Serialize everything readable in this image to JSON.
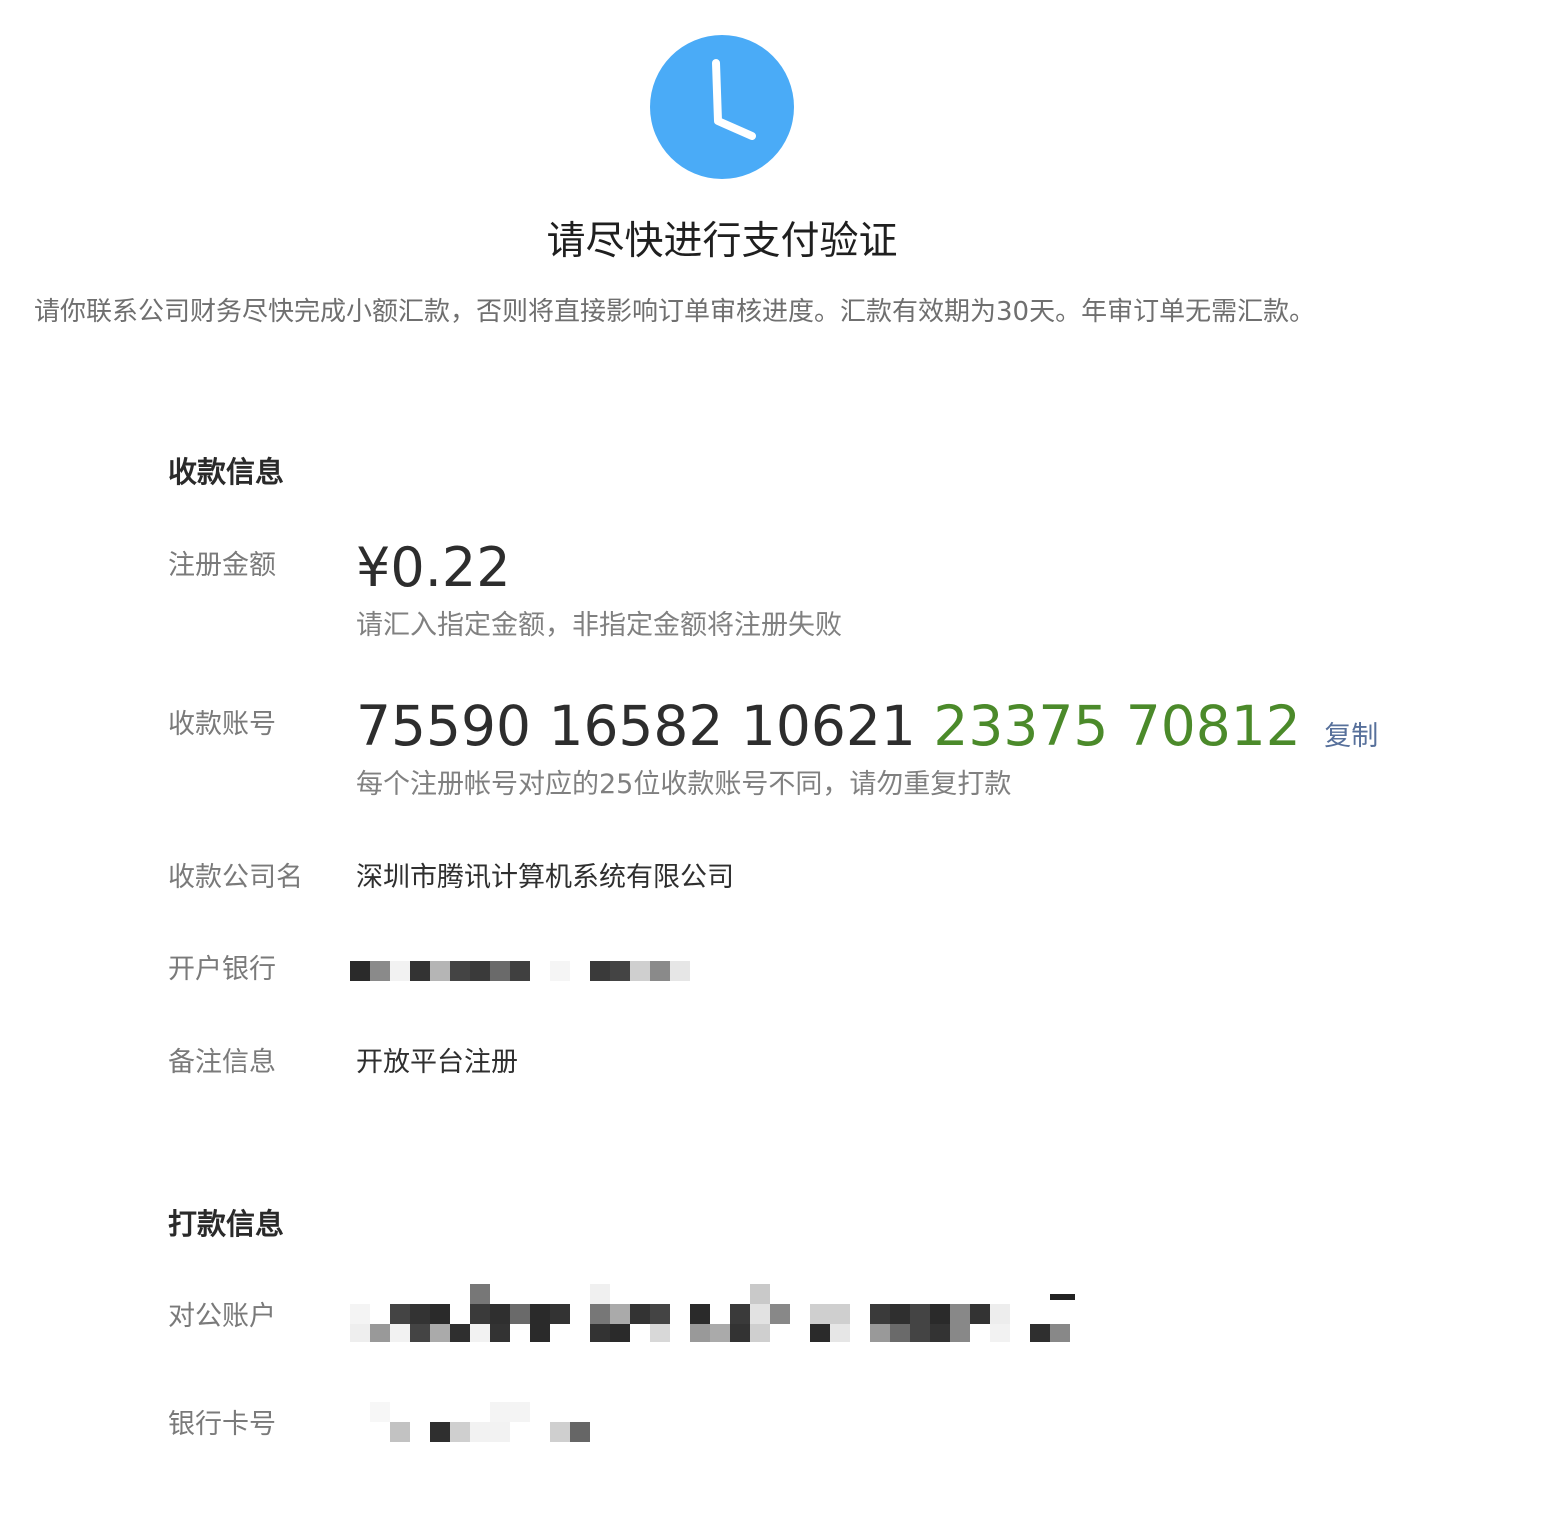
{
  "header": {
    "icon": "clock-icon",
    "icon_color": "#4aabf7",
    "title": "请尽快进行支付验证",
    "subtitle": "请你联系公司财务尽快完成小额汇款，否则将直接影响订单审核进度。汇款有效期为30天。年审订单无需汇款。"
  },
  "receive": {
    "section_title": "收款信息",
    "amount": {
      "label": "注册金额",
      "value": "¥0.22",
      "hint": "请汇入指定金额，非指定金额将注册失败"
    },
    "account": {
      "label": "收款账号",
      "groups_plain": "75590 16582 10621",
      "groups_highlight": "23375 70812",
      "highlight_color": "#4b8a2a",
      "copy_label": "复制",
      "hint": "每个注册帐号对应的25位收款账号不同，请勿重复打款"
    },
    "company": {
      "label": "收款公司名",
      "value": "深圳市腾讯计算机系统有限公司"
    },
    "bank": {
      "label": "开户银行"
    },
    "remark": {
      "label": "备注信息",
      "value": "开放平台注册"
    }
  },
  "payment": {
    "section_title": "打款信息",
    "corporate_account": {
      "label": "对公账户"
    },
    "bank_card": {
      "label": "银行卡号"
    }
  }
}
